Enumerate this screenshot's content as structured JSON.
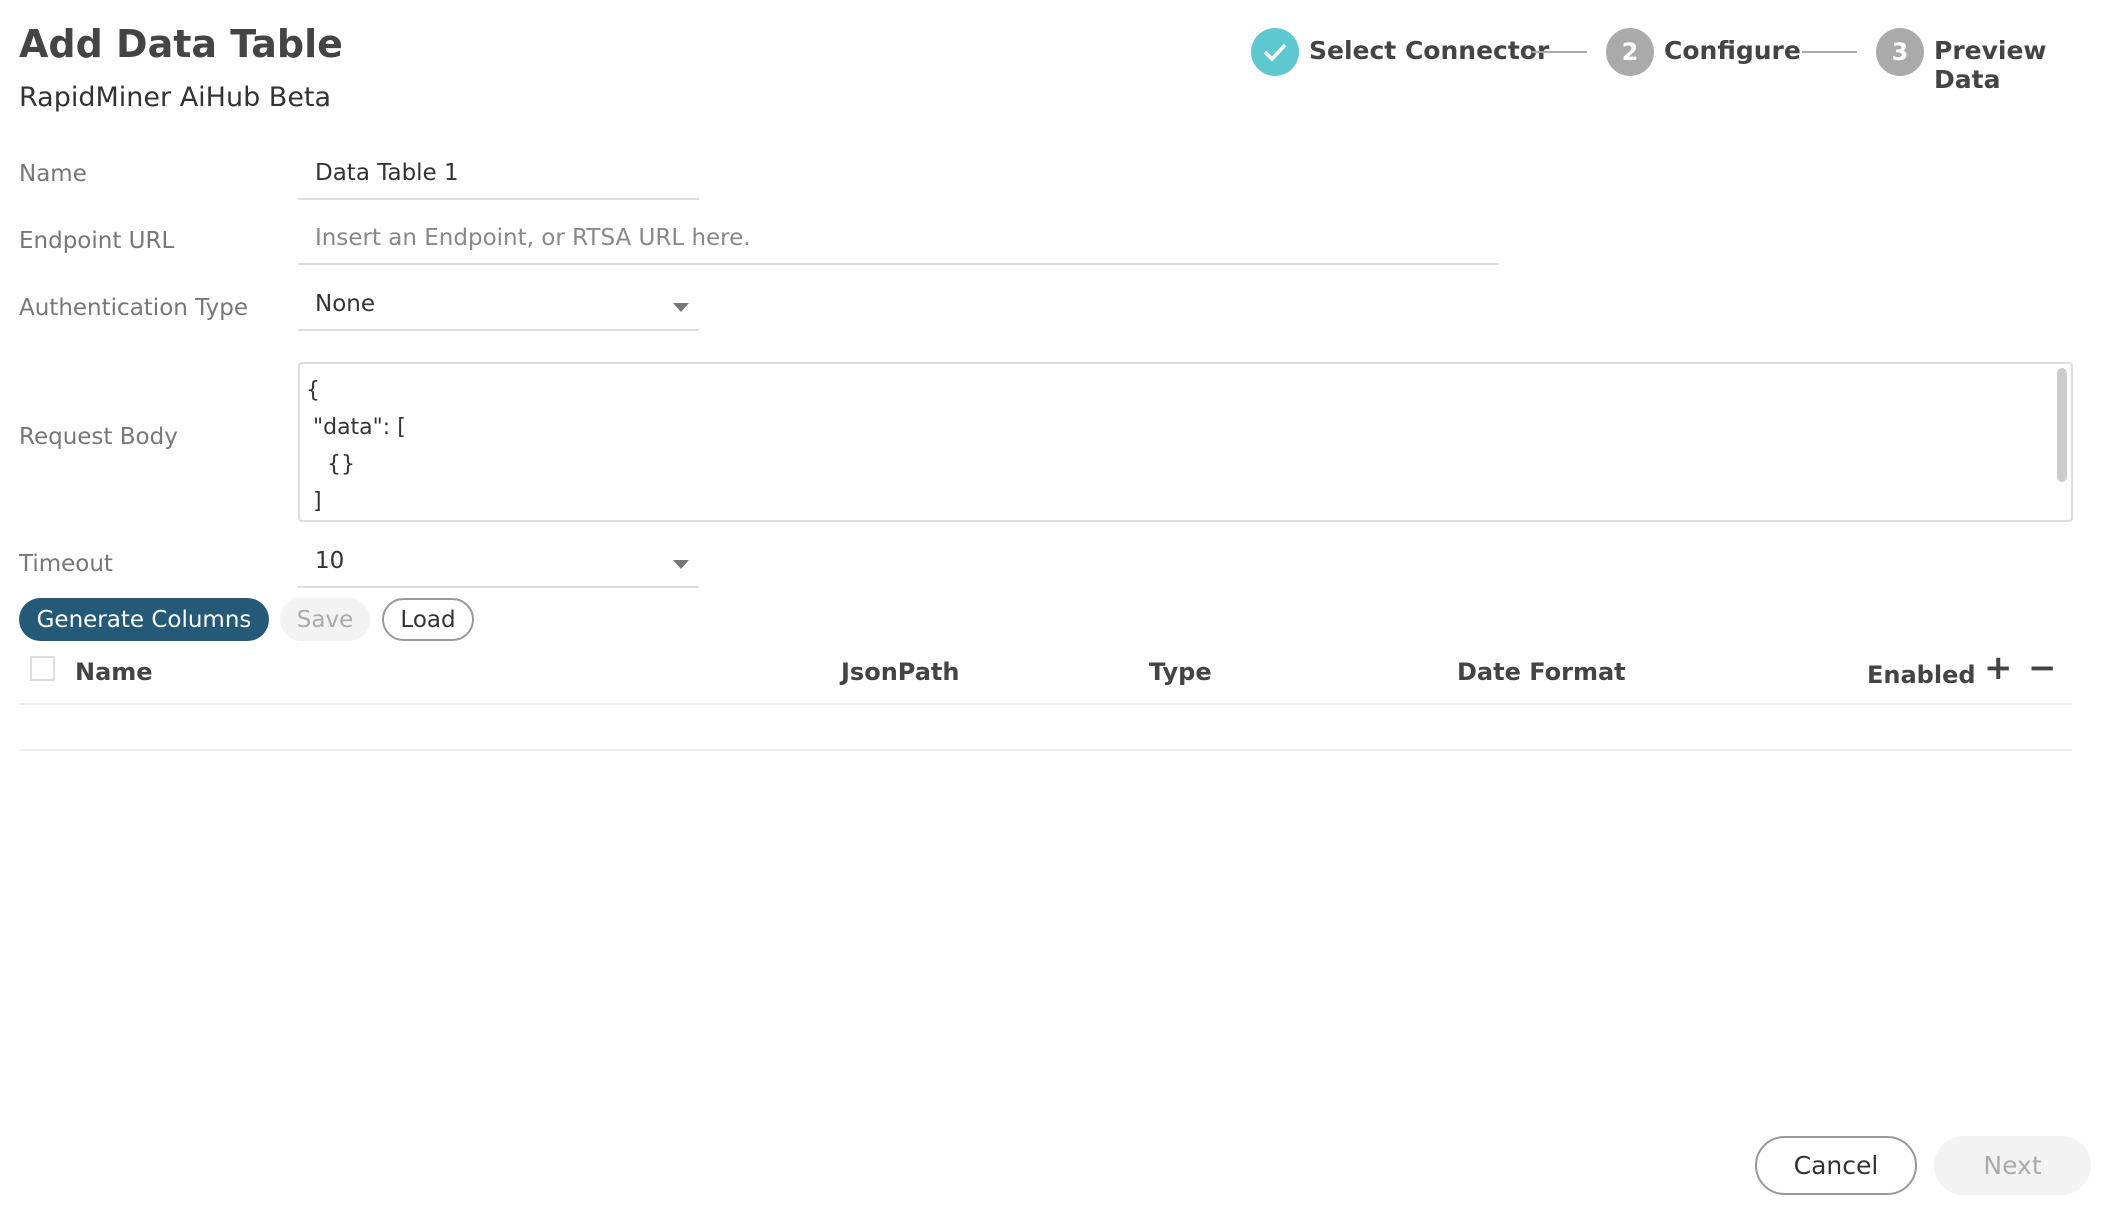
{
  "header": {
    "title": "Add Data Table",
    "subtitle": "RapidMiner AiHub Beta"
  },
  "stepper": {
    "steps": [
      {
        "label": "Select Connector",
        "marker": "check-icon",
        "state": "complete",
        "color": "#5ec8d0"
      },
      {
        "label": "Configure",
        "marker": "2",
        "state": "pending",
        "color": "#aaaaaa"
      },
      {
        "label": "Preview Data",
        "marker": "3",
        "state": "pending",
        "color": "#aaaaaa"
      }
    ]
  },
  "form": {
    "name": {
      "label": "Name",
      "value": "Data Table 1"
    },
    "endpoint": {
      "label": "Endpoint URL",
      "placeholder": "Insert an Endpoint, or RTSA URL here."
    },
    "auth": {
      "label": "Authentication Type",
      "value": "None"
    },
    "request_body": {
      "label": "Request Body",
      "value": "{\n \"data\": [\n   {}\n ]"
    },
    "timeout": {
      "label": "Timeout",
      "value": "10"
    }
  },
  "actions": {
    "generate": "Generate Columns",
    "save": "Save",
    "load": "Load",
    "primary_color": "#245a78"
  },
  "table": {
    "columns": [
      "Name",
      "JsonPath",
      "Type",
      "Date Format",
      "Enabled"
    ],
    "add": "+",
    "remove": "−",
    "rows": []
  },
  "footer": {
    "cancel": "Cancel",
    "next": "Next"
  }
}
